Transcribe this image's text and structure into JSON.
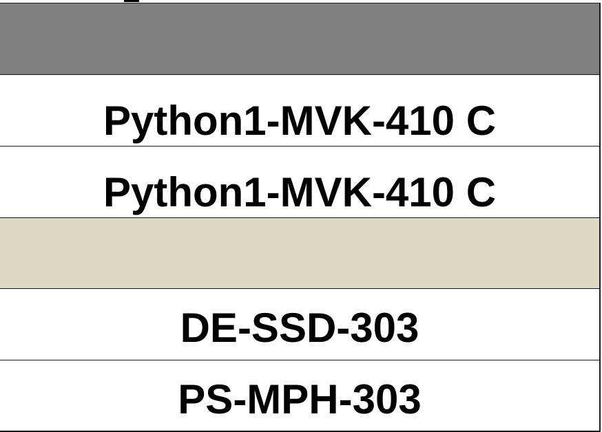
{
  "rows": [
    {
      "kind": "header",
      "text": ""
    },
    {
      "kind": "item",
      "text": "Python1-MVK-410 C"
    },
    {
      "kind": "item",
      "text": "Python1-MVK-410 C"
    },
    {
      "kind": "section",
      "text": ""
    },
    {
      "kind": "item",
      "text": "DE-SSD-303"
    },
    {
      "kind": "item",
      "text": "PS-MPH-303"
    }
  ],
  "colors": {
    "header_fill": "#7f7f7f",
    "section_fill": "#ddd9c4",
    "grid_line": "#1a1a1a"
  }
}
